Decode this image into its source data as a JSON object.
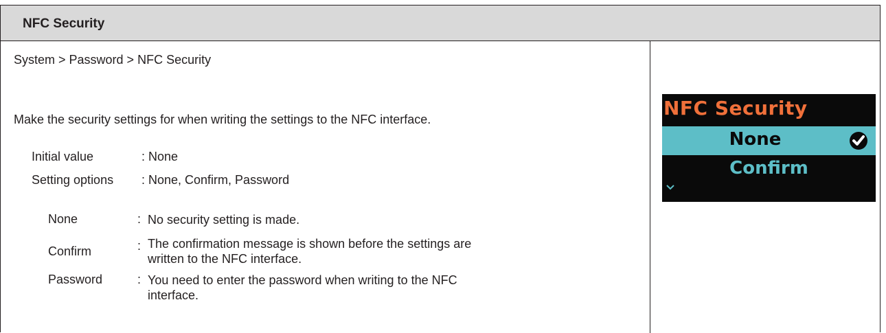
{
  "header": {
    "title": "NFC Security"
  },
  "content": {
    "breadcrumb": "System > Password > NFC Security",
    "description": "Make the security settings for when writing the settings to the NFC interface.",
    "initial_value": {
      "key": "Initial value",
      "value": ": None"
    },
    "setting_options": {
      "key": "Setting options",
      "value": ": None, Confirm, Password"
    },
    "options": [
      {
        "name": "None",
        "colon": ":",
        "description": "No security setting is made."
      },
      {
        "name": "Confirm",
        "colon": ":",
        "description": "The confirmation message is shown before the settings are written to the NFC interface."
      },
      {
        "name": "Password",
        "colon": ":",
        "description": "You need to enter the password when writing to the NFC interface."
      }
    ]
  },
  "device_screen": {
    "title": "NFC Security",
    "selected_item": "None",
    "next_item": "Confirm",
    "selected_icon": "check-circle-icon",
    "more_icon": "chevron-down-icon",
    "colors": {
      "background": "#0a0a0a",
      "title": "#f0703a",
      "highlight": "#5dbec7"
    }
  }
}
